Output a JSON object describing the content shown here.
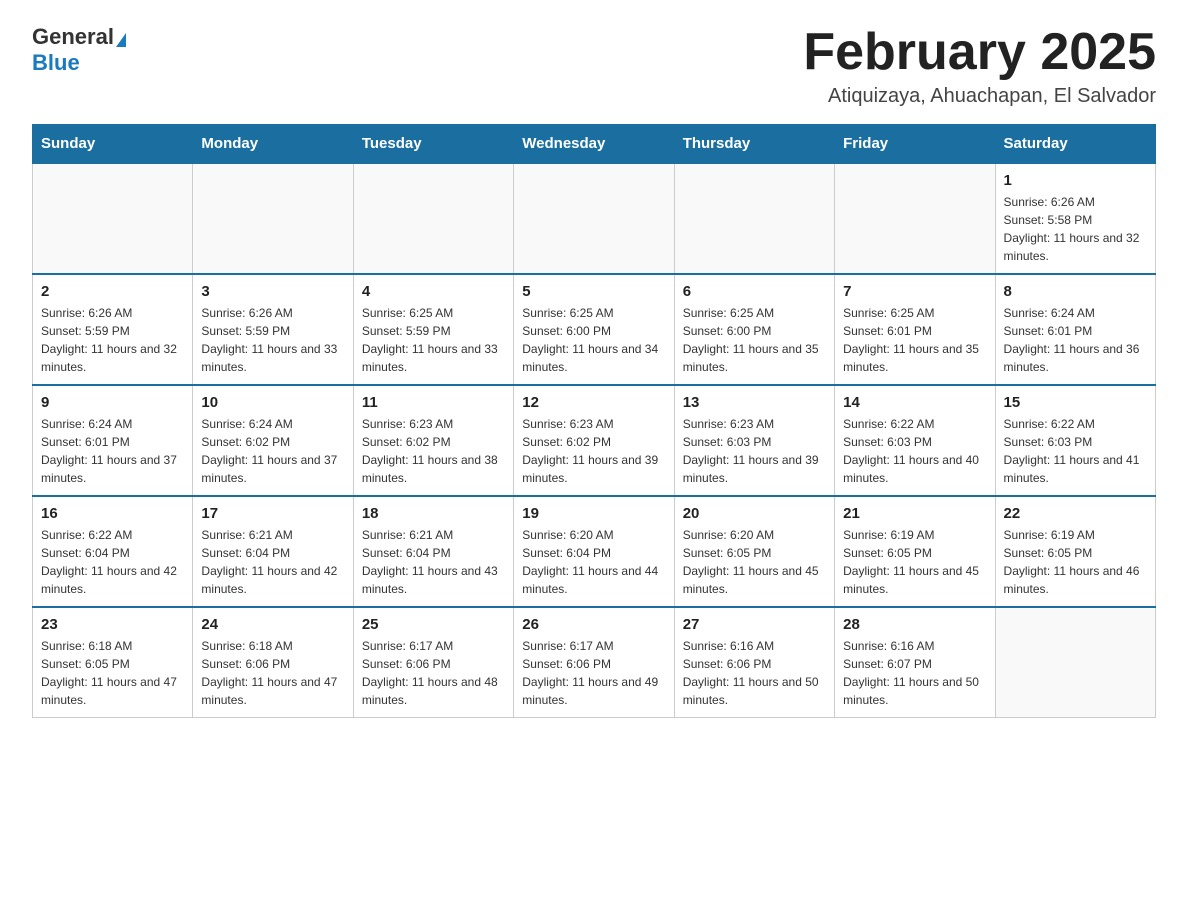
{
  "header": {
    "logo_general": "General",
    "logo_blue": "Blue",
    "month_title": "February 2025",
    "location": "Atiquizaya, Ahuachapan, El Salvador"
  },
  "days_of_week": [
    "Sunday",
    "Monday",
    "Tuesday",
    "Wednesday",
    "Thursday",
    "Friday",
    "Saturday"
  ],
  "weeks": [
    [
      {
        "day": "",
        "sunrise": "",
        "sunset": "",
        "daylight": ""
      },
      {
        "day": "",
        "sunrise": "",
        "sunset": "",
        "daylight": ""
      },
      {
        "day": "",
        "sunrise": "",
        "sunset": "",
        "daylight": ""
      },
      {
        "day": "",
        "sunrise": "",
        "sunset": "",
        "daylight": ""
      },
      {
        "day": "",
        "sunrise": "",
        "sunset": "",
        "daylight": ""
      },
      {
        "day": "",
        "sunrise": "",
        "sunset": "",
        "daylight": ""
      },
      {
        "day": "1",
        "sunrise": "Sunrise: 6:26 AM",
        "sunset": "Sunset: 5:58 PM",
        "daylight": "Daylight: 11 hours and 32 minutes."
      }
    ],
    [
      {
        "day": "2",
        "sunrise": "Sunrise: 6:26 AM",
        "sunset": "Sunset: 5:59 PM",
        "daylight": "Daylight: 11 hours and 32 minutes."
      },
      {
        "day": "3",
        "sunrise": "Sunrise: 6:26 AM",
        "sunset": "Sunset: 5:59 PM",
        "daylight": "Daylight: 11 hours and 33 minutes."
      },
      {
        "day": "4",
        "sunrise": "Sunrise: 6:25 AM",
        "sunset": "Sunset: 5:59 PM",
        "daylight": "Daylight: 11 hours and 33 minutes."
      },
      {
        "day": "5",
        "sunrise": "Sunrise: 6:25 AM",
        "sunset": "Sunset: 6:00 PM",
        "daylight": "Daylight: 11 hours and 34 minutes."
      },
      {
        "day": "6",
        "sunrise": "Sunrise: 6:25 AM",
        "sunset": "Sunset: 6:00 PM",
        "daylight": "Daylight: 11 hours and 35 minutes."
      },
      {
        "day": "7",
        "sunrise": "Sunrise: 6:25 AM",
        "sunset": "Sunset: 6:01 PM",
        "daylight": "Daylight: 11 hours and 35 minutes."
      },
      {
        "day": "8",
        "sunrise": "Sunrise: 6:24 AM",
        "sunset": "Sunset: 6:01 PM",
        "daylight": "Daylight: 11 hours and 36 minutes."
      }
    ],
    [
      {
        "day": "9",
        "sunrise": "Sunrise: 6:24 AM",
        "sunset": "Sunset: 6:01 PM",
        "daylight": "Daylight: 11 hours and 37 minutes."
      },
      {
        "day": "10",
        "sunrise": "Sunrise: 6:24 AM",
        "sunset": "Sunset: 6:02 PM",
        "daylight": "Daylight: 11 hours and 37 minutes."
      },
      {
        "day": "11",
        "sunrise": "Sunrise: 6:23 AM",
        "sunset": "Sunset: 6:02 PM",
        "daylight": "Daylight: 11 hours and 38 minutes."
      },
      {
        "day": "12",
        "sunrise": "Sunrise: 6:23 AM",
        "sunset": "Sunset: 6:02 PM",
        "daylight": "Daylight: 11 hours and 39 minutes."
      },
      {
        "day": "13",
        "sunrise": "Sunrise: 6:23 AM",
        "sunset": "Sunset: 6:03 PM",
        "daylight": "Daylight: 11 hours and 39 minutes."
      },
      {
        "day": "14",
        "sunrise": "Sunrise: 6:22 AM",
        "sunset": "Sunset: 6:03 PM",
        "daylight": "Daylight: 11 hours and 40 minutes."
      },
      {
        "day": "15",
        "sunrise": "Sunrise: 6:22 AM",
        "sunset": "Sunset: 6:03 PM",
        "daylight": "Daylight: 11 hours and 41 minutes."
      }
    ],
    [
      {
        "day": "16",
        "sunrise": "Sunrise: 6:22 AM",
        "sunset": "Sunset: 6:04 PM",
        "daylight": "Daylight: 11 hours and 42 minutes."
      },
      {
        "day": "17",
        "sunrise": "Sunrise: 6:21 AM",
        "sunset": "Sunset: 6:04 PM",
        "daylight": "Daylight: 11 hours and 42 minutes."
      },
      {
        "day": "18",
        "sunrise": "Sunrise: 6:21 AM",
        "sunset": "Sunset: 6:04 PM",
        "daylight": "Daylight: 11 hours and 43 minutes."
      },
      {
        "day": "19",
        "sunrise": "Sunrise: 6:20 AM",
        "sunset": "Sunset: 6:04 PM",
        "daylight": "Daylight: 11 hours and 44 minutes."
      },
      {
        "day": "20",
        "sunrise": "Sunrise: 6:20 AM",
        "sunset": "Sunset: 6:05 PM",
        "daylight": "Daylight: 11 hours and 45 minutes."
      },
      {
        "day": "21",
        "sunrise": "Sunrise: 6:19 AM",
        "sunset": "Sunset: 6:05 PM",
        "daylight": "Daylight: 11 hours and 45 minutes."
      },
      {
        "day": "22",
        "sunrise": "Sunrise: 6:19 AM",
        "sunset": "Sunset: 6:05 PM",
        "daylight": "Daylight: 11 hours and 46 minutes."
      }
    ],
    [
      {
        "day": "23",
        "sunrise": "Sunrise: 6:18 AM",
        "sunset": "Sunset: 6:05 PM",
        "daylight": "Daylight: 11 hours and 47 minutes."
      },
      {
        "day": "24",
        "sunrise": "Sunrise: 6:18 AM",
        "sunset": "Sunset: 6:06 PM",
        "daylight": "Daylight: 11 hours and 47 minutes."
      },
      {
        "day": "25",
        "sunrise": "Sunrise: 6:17 AM",
        "sunset": "Sunset: 6:06 PM",
        "daylight": "Daylight: 11 hours and 48 minutes."
      },
      {
        "day": "26",
        "sunrise": "Sunrise: 6:17 AM",
        "sunset": "Sunset: 6:06 PM",
        "daylight": "Daylight: 11 hours and 49 minutes."
      },
      {
        "day": "27",
        "sunrise": "Sunrise: 6:16 AM",
        "sunset": "Sunset: 6:06 PM",
        "daylight": "Daylight: 11 hours and 50 minutes."
      },
      {
        "day": "28",
        "sunrise": "Sunrise: 6:16 AM",
        "sunset": "Sunset: 6:07 PM",
        "daylight": "Daylight: 11 hours and 50 minutes."
      },
      {
        "day": "",
        "sunrise": "",
        "sunset": "",
        "daylight": ""
      }
    ]
  ]
}
